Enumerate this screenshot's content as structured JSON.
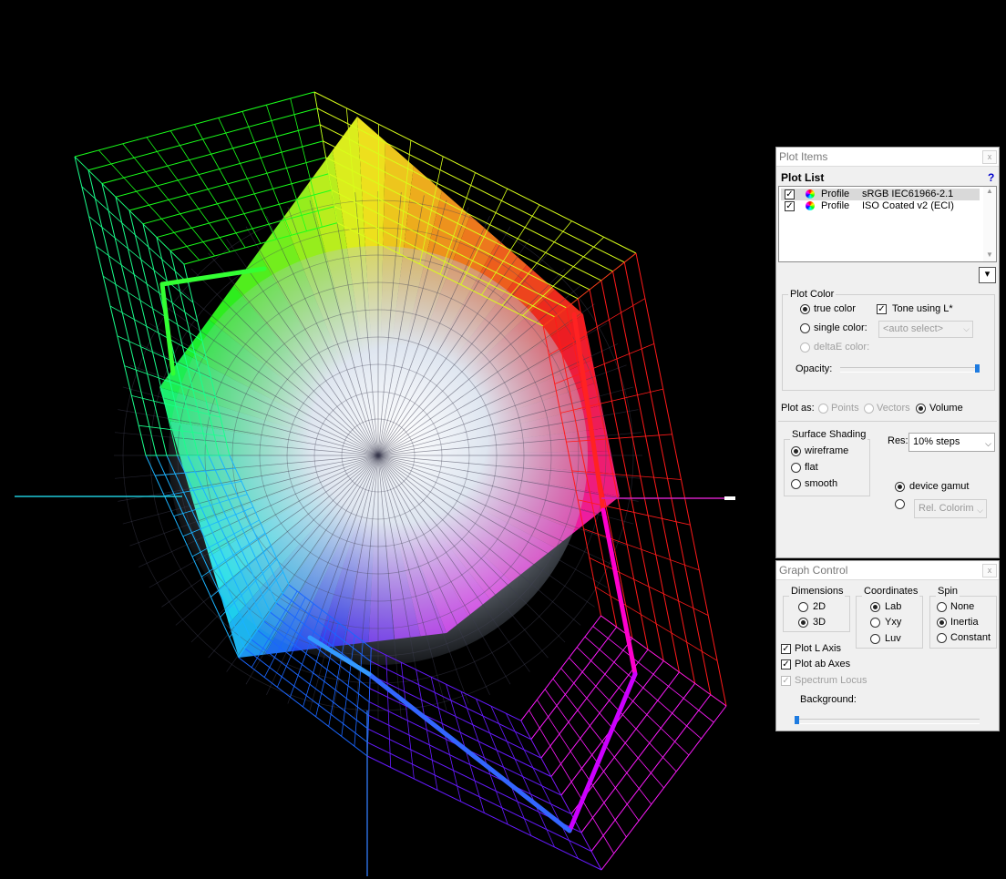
{
  "plot_items": {
    "title": "Plot Items",
    "close_label": "x",
    "plot_list_label": "Plot List",
    "help_label": "?",
    "items": [
      {
        "checked": true,
        "type": "Profile",
        "name": "sRGB IEC61966-2.1",
        "selected": true
      },
      {
        "checked": true,
        "type": "Profile",
        "name": "ISO Coated v2 (ECI)",
        "selected": false
      }
    ],
    "menu_button_label": "▾",
    "plot_color": {
      "group_label": "Plot Color",
      "true_color": "true color",
      "single_color": "single color:",
      "deltae_color": "deltaE color:",
      "tone_using_l": "Tone using L*",
      "auto_select": "<auto select>",
      "opacity_label": "Opacity:",
      "opacity_value": 1.0
    },
    "plot_as": {
      "label": "Plot as:",
      "points": "Points",
      "vectors": "Vectors",
      "volume": "Volume",
      "selected": "Volume"
    },
    "surface_shading": {
      "group_label": "Surface Shading",
      "wireframe": "wireframe",
      "flat": "flat",
      "smooth": "smooth",
      "selected": "wireframe"
    },
    "res_label": "Res:",
    "res_value": "10% steps",
    "device_gamut": "device gamut",
    "rel_colorim": "Rel. Colorim"
  },
  "graph_control": {
    "title": "Graph Control",
    "close_label": "x",
    "dimensions": {
      "label": "Dimensions",
      "options": [
        "2D",
        "3D"
      ],
      "selected": "3D"
    },
    "coordinates": {
      "label": "Coordinates",
      "options": [
        "Lab",
        "Yxy",
        "Luv"
      ],
      "selected": "Lab"
    },
    "spin": {
      "label": "Spin",
      "options": [
        "None",
        "Inertia",
        "Constant"
      ],
      "selected": "Inertia"
    },
    "plot_l_axis": "Plot L Axis",
    "plot_ab_axes": "Plot ab Axes",
    "spectrum_locus": "Spectrum Locus",
    "background_label": "Background:",
    "background_value": 0.0
  },
  "colors": {
    "viewport_bg": "#000000",
    "panel_bg": "#f0f0f0",
    "selected_row": "#d9d9d9",
    "slider_thumb": "#1e7be0",
    "help_blue": "#0000cc"
  }
}
